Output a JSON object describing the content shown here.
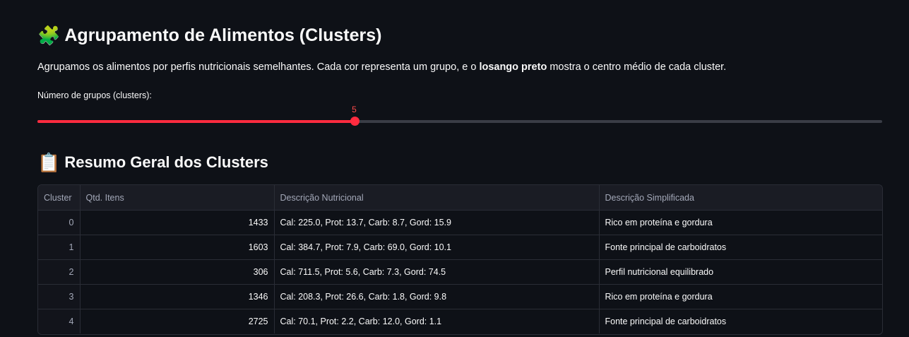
{
  "header": {
    "title_emoji": "🧩",
    "title": "Agrupamento de Alimentos (Clusters)"
  },
  "intro": {
    "text_before": "Agrupamos os alimentos por perfis nutricionais semelhantes. Cada cor representa um grupo, e o ",
    "text_bold": "losango preto",
    "text_after": " mostra o centro médio de cada cluster."
  },
  "slider": {
    "label": "Número de grupos (clusters):",
    "value": 5,
    "value_label": "5",
    "value_fraction": 0.375,
    "accent_color": "#ff2b3f"
  },
  "summary": {
    "title_emoji": "📋",
    "title": "Resumo Geral dos Clusters",
    "columns": [
      "Cluster",
      "Qtd. Itens",
      "Descrição Nutricional",
      "Descrição Simplificada"
    ],
    "rows": [
      [
        "0",
        "1433",
        "Cal: 225.0, Prot: 13.7, Carb: 8.7, Gord: 15.9",
        "Rico em proteína e gordura"
      ],
      [
        "1",
        "1603",
        "Cal: 384.7, Prot: 7.9, Carb: 69.0, Gord: 10.1",
        "Fonte principal de carboidratos"
      ],
      [
        "2",
        "306",
        "Cal: 711.5, Prot: 5.6, Carb: 7.3, Gord: 74.5",
        "Perfil nutricional equilibrado"
      ],
      [
        "3",
        "1346",
        "Cal: 208.3, Prot: 26.6, Carb: 1.8, Gord: 9.8",
        "Rico em proteína e gordura"
      ],
      [
        "4",
        "2725",
        "Cal: 70.1, Prot: 2.2, Carb: 12.0, Gord: 1.1",
        "Fonte principal de carboidratos"
      ]
    ]
  }
}
